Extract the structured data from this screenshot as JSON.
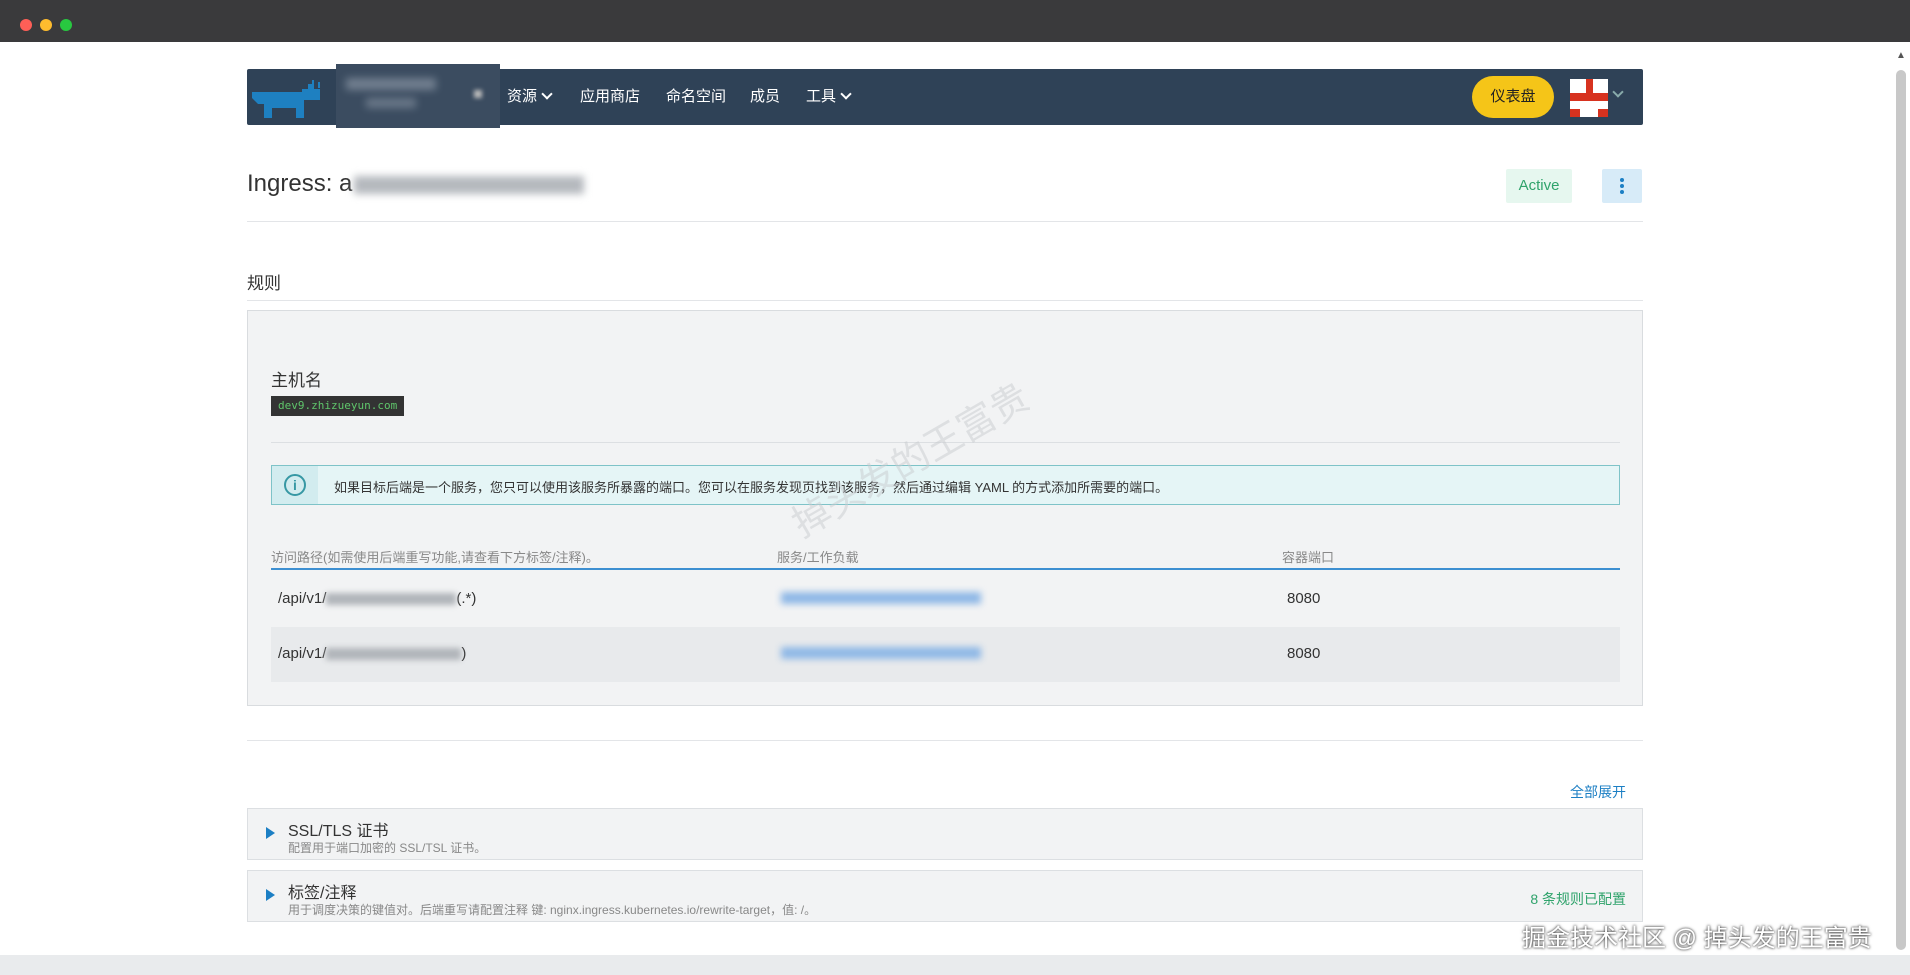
{
  "nav": {
    "items": [
      {
        "label": "资源",
        "has_dropdown": true
      },
      {
        "label": "应用商店",
        "has_dropdown": false
      },
      {
        "label": "命名空间",
        "has_dropdown": false
      },
      {
        "label": "成员",
        "has_dropdown": false
      },
      {
        "label": "工具",
        "has_dropdown": true
      }
    ],
    "dashboard_label": "仪表盘"
  },
  "page": {
    "title": "Ingress: a",
    "status": "Active"
  },
  "rules": {
    "section_title": "规则",
    "hostname_label": "主机名",
    "hostname": "dev9.zhizueyun.com",
    "info": "如果目标后端是一个服务，您只可以使用该服务所暴露的端口。您可以在服务发现页找到该服务，然后通过编辑 YAML 的方式添加所需要的端口。",
    "columns": [
      "访问路径(如需使用后端重写功能,请查看下方标签/注释)。",
      "服务/工作负载",
      "容器端口"
    ],
    "rows": [
      {
        "path_prefix": "/api/v1/",
        "path_suffix": "(.*)",
        "port": "8080"
      },
      {
        "path_prefix": "/api/v1/",
        "path_suffix": ")",
        "port": "8080"
      }
    ]
  },
  "accordion": {
    "expand_all": "全部展开",
    "items": [
      {
        "title": "SSL/TLS 证书",
        "subtitle": "配置用于端口加密的 SSL/TSL 证书。",
        "status": ""
      },
      {
        "title": "标签/注释",
        "subtitle": "用于调度决策的键值对。后端重写请配置注释 键: nginx.ingress.kubernetes.io/rewrite-target，值: /。",
        "status": "8 条规则已配置"
      }
    ]
  },
  "watermarks": {
    "diagonal": "掉头发的王富贵",
    "corner": "掘金技术社区 @ 掉头发的王富贵"
  },
  "colors": {
    "nav_bg": "#2f4257",
    "accent": "#1c7fc4",
    "active_green": "#2fa36b",
    "dashboard_yellow": "#f5c518"
  }
}
